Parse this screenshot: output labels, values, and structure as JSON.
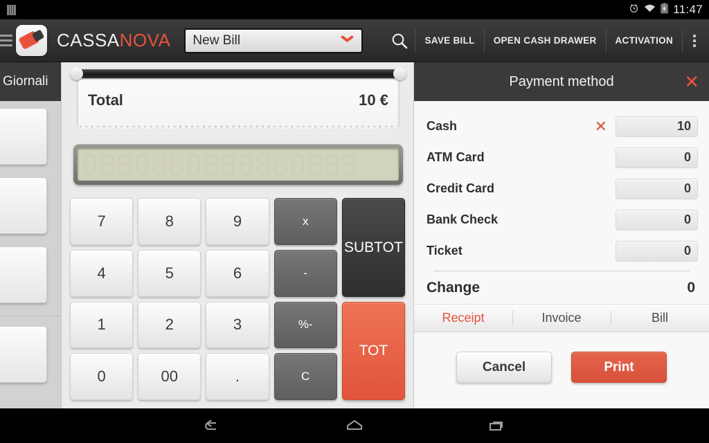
{
  "statusbar": {
    "time": "11:47",
    "icons": [
      "sim-icon",
      "alarm-icon",
      "wifi-icon",
      "battery-charging-icon"
    ]
  },
  "actionbar": {
    "menu_icon": "hamburger-menu-icon",
    "logo_icon": "cassanova-logo-icon",
    "brand_part1": "CASSA",
    "brand_part2": "NOVA",
    "bill_select_value": "New Bill",
    "search_icon": "search-icon",
    "buttons": [
      {
        "label": "SAVE BILL"
      },
      {
        "label": "OPEN CASH DRAWER"
      },
      {
        "label": "ACTIVATION"
      }
    ],
    "overflow_icon": "overflow-menu-icon"
  },
  "leftpane": {
    "title": "Giornali"
  },
  "receipt": {
    "total_label": "Total",
    "total_value": "10 €"
  },
  "display": {
    "value": "",
    "segment_count": 16
  },
  "keypad": [
    {
      "label": "7",
      "type": "digit"
    },
    {
      "label": "8",
      "type": "digit"
    },
    {
      "label": "9",
      "type": "digit"
    },
    {
      "label": "x",
      "type": "op"
    },
    {
      "label": "SUB\nTOT",
      "type": "subtot"
    },
    {
      "label": "4",
      "type": "digit"
    },
    {
      "label": "5",
      "type": "digit"
    },
    {
      "label": "6",
      "type": "digit"
    },
    {
      "label": "-",
      "type": "op"
    },
    {
      "label": "1",
      "type": "digit"
    },
    {
      "label": "2",
      "type": "digit"
    },
    {
      "label": "3",
      "type": "digit"
    },
    {
      "label": "%-",
      "type": "op"
    },
    {
      "label": "TOT",
      "type": "tot"
    },
    {
      "label": "0",
      "type": "digit"
    },
    {
      "label": "00",
      "type": "digit"
    },
    {
      "label": ".",
      "type": "digit"
    },
    {
      "label": "C",
      "type": "op"
    }
  ],
  "payment": {
    "title": "Payment method",
    "close_icon": "close-icon",
    "rows": [
      {
        "label": "Cash",
        "value": "10",
        "clear_icon": "clear-icon",
        "has_clear": true
      },
      {
        "label": "ATM Card",
        "value": "0",
        "clear_icon": "clear-icon",
        "has_clear": false
      },
      {
        "label": "Credit Card",
        "value": "0",
        "clear_icon": "clear-icon",
        "has_clear": false
      },
      {
        "label": "Bank Check",
        "value": "0",
        "clear_icon": "clear-icon",
        "has_clear": false
      },
      {
        "label": "Ticket",
        "value": "0",
        "clear_icon": "clear-icon",
        "has_clear": false
      }
    ],
    "change_label": "Change",
    "change_value": "0",
    "doc_tabs": [
      {
        "label": "Receipt",
        "active": true
      },
      {
        "label": "Invoice",
        "active": false
      },
      {
        "label": "Bill",
        "active": false
      }
    ],
    "cancel_label": "Cancel",
    "print_label": "Print"
  },
  "navbar": {
    "back_icon": "back-icon",
    "home_icon": "home-icon",
    "recents_icon": "recent-apps-icon"
  },
  "colors": {
    "accent": "#e8523c",
    "actionbar": "#323232",
    "panel_bg": "#f8f8f8",
    "lcd": "#d2d3bc"
  }
}
